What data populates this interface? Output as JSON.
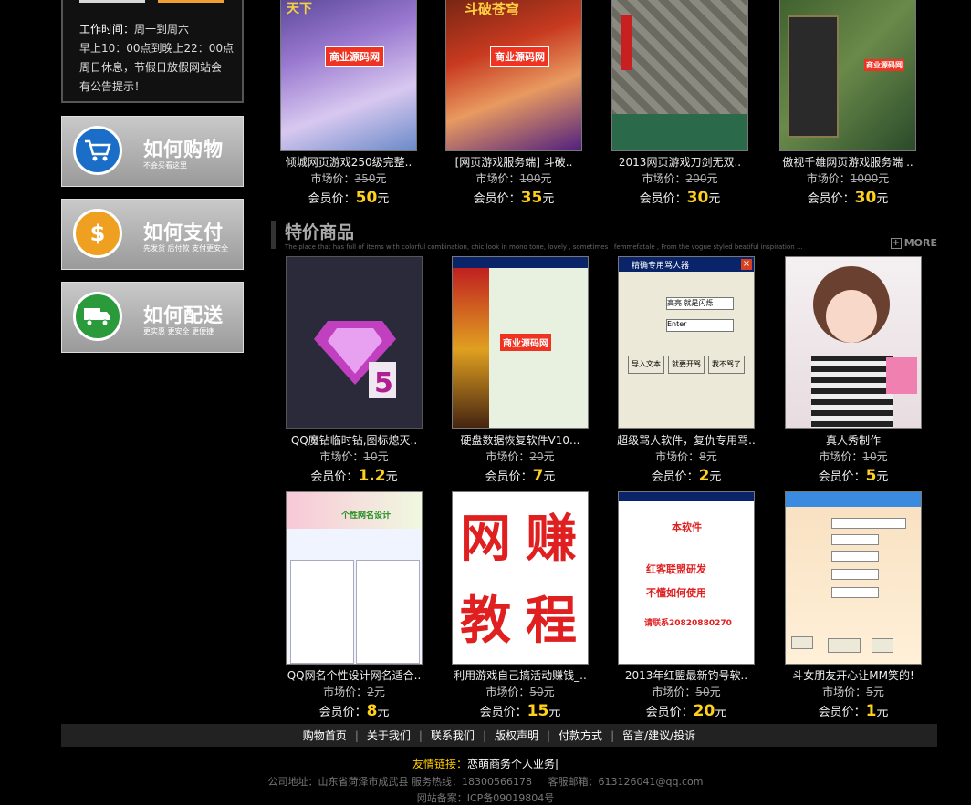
{
  "sidebar": {
    "hours_label": "工作时间：",
    "hours_line1": "周一到周六",
    "hours_line2": "早上10：00点到晚上22：00点",
    "hours_line3": "周日休息，节假日放假网站会",
    "hours_line4": "有公告提示！",
    "btn_buy_title": "如何购物",
    "btn_buy_sub": "不会买看这里",
    "btn_pay_title": "如何支付",
    "btn_pay_sub": "先发货 后付款 支付更安全",
    "btn_ship_title": "如何配送",
    "btn_ship_sub": "更实惠 更安全 更便捷"
  },
  "labels": {
    "market": "市场价：",
    "member": "会员价：",
    "yuan": "元"
  },
  "top_products": [
    {
      "name": "倾城网页游戏250级完整..",
      "market": "350",
      "member": "50"
    },
    {
      "name": "[网页游戏服务端] 斗破..",
      "market": "100",
      "member": "35"
    },
    {
      "name": "2013网页游戏刀剑无双..",
      "market": "200",
      "member": "30"
    },
    {
      "name": "傲视千雄网页游戏服务端 ..",
      "market": "1000",
      "member": "30"
    }
  ],
  "section": {
    "title": "特价商品",
    "subtitle": "The place that has full of items with colorful combination, chic look in mono tone, lovely , sometimes , femmefatale , From the vogue styled beatiful inspiration ...",
    "more": "MORE"
  },
  "special_products": [
    {
      "name": "QQ魔钻临时钻,图标熄灭..",
      "market": "10",
      "member": "1.2"
    },
    {
      "name": "硬盘数据恢复软件V10...",
      "market": "20",
      "member": "7"
    },
    {
      "name": "超级骂人软件，复仇专用骂..",
      "market": "8",
      "member": "2"
    },
    {
      "name": "真人秀制作",
      "market": "10",
      "member": "5"
    },
    {
      "name": "QQ网名个性设计网名适合..",
      "market": "2",
      "member": "8"
    },
    {
      "name": "利用游戏自己搞活动赚钱_..",
      "market": "50",
      "member": "15"
    },
    {
      "name": "2013年红盟最新钓号软..",
      "market": "50",
      "member": "20"
    },
    {
      "name": "斗女朋友开心让MM笑的!",
      "market": "5",
      "member": "1"
    }
  ],
  "thumb_text": {
    "watermark": "商业源码网",
    "t1_top": "天下",
    "t2_top": "斗破苍穹",
    "t5_header": "个性网名设计",
    "t6_chars": [
      "网",
      "赚",
      "教",
      "程"
    ],
    "t7_line1": "本软件",
    "t7_line2": "红客联盟研发",
    "t7_line3": "不懂如何使用",
    "t7_line4": "请联系20820880270",
    "t3_title": "精确专用骂人器",
    "t3_btn1": "导入文本",
    "t3_btn2": "就要开骂",
    "t3_btn3": "我不骂了",
    "t3_mode": "Enter",
    "t3_speed": "高亮 就是闪烁"
  },
  "footer": {
    "nav": [
      "购物首页",
      "关于我们",
      "联系我们",
      "版权声明",
      "付款方式",
      "留言/建议/投诉"
    ],
    "friend_label": "友情链接：",
    "friend_link": "恋萌商务个人业务",
    "friend_sep": "|",
    "address": "公司地址：山东省菏泽市成武县 服务热线：18300566178",
    "email_label": "客服邮箱：613126041@qq.com",
    "icp": "网站备案：ICP备09019804号"
  },
  "colors": {
    "background": "#000000",
    "price_highlight": "#ffd11a",
    "buy_icon": "#1a6ec8",
    "pay_icon": "#f0a020",
    "ship_icon": "#2a9a3a",
    "friend_label": "#ffcc00"
  }
}
